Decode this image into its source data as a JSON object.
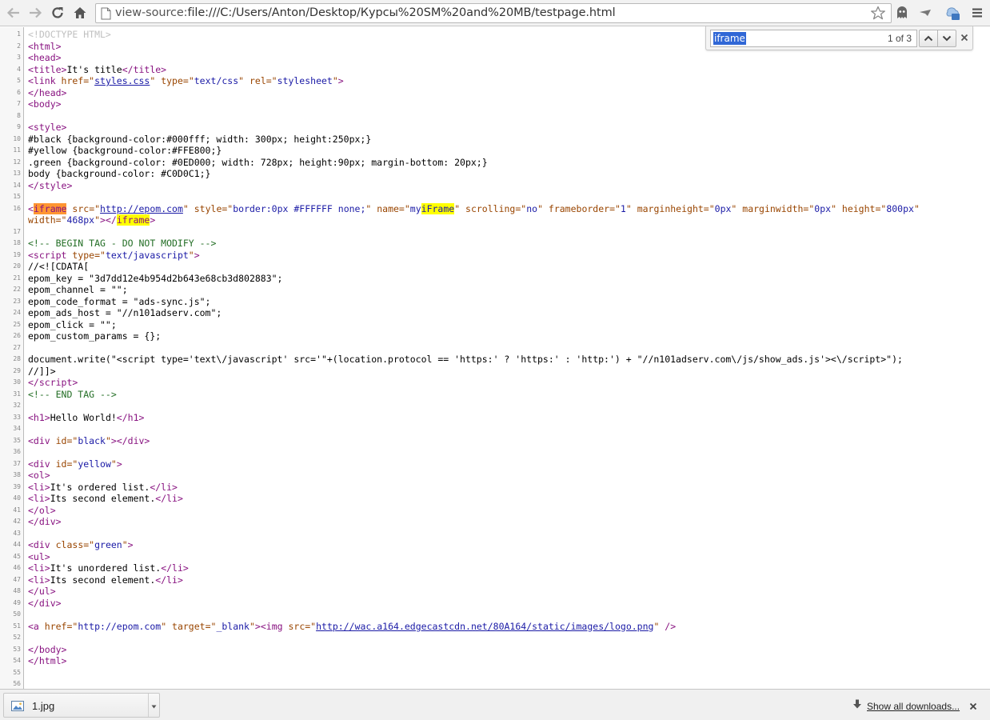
{
  "toolbar": {
    "url_scheme": "view-source:",
    "url_rest": "file:///C:/Users/Anton/Desktop/Курсы%20SM%20and%20MB/testpage.html"
  },
  "find": {
    "query": "iframe",
    "count": "1 of 3"
  },
  "source_lines": [
    {
      "n": "1",
      "html": "<span class=\"doctype\">&lt;!DOCTYPE HTML&gt;</span>"
    },
    {
      "n": "2",
      "html": "<span class=\"tag\">&lt;html&gt;</span>"
    },
    {
      "n": "3",
      "html": "<span class=\"tag\">&lt;head&gt;</span>"
    },
    {
      "n": "4",
      "html": "<span class=\"tag\">&lt;title&gt;</span>It's title<span class=\"tag\">&lt;/title&gt;</span>"
    },
    {
      "n": "5",
      "html": "<span class=\"tag\">&lt;link </span><span class=\"attr\">href=\"</span><span class=\"link\">styles.css</span><span class=\"attr\">\" </span><span class=\"attr\">type=\"</span><span class=\"val\">text/css</span><span class=\"attr\">\" rel=\"</span><span class=\"val\">stylesheet</span><span class=\"attr\">\"</span><span class=\"tag\">&gt;</span>"
    },
    {
      "n": "6",
      "html": "<span class=\"tag\">&lt;/head&gt;</span>"
    },
    {
      "n": "7",
      "html": "<span class=\"tag\">&lt;body&gt;</span>"
    },
    {
      "n": "8",
      "html": ""
    },
    {
      "n": "9",
      "html": "<span class=\"tag\">&lt;style&gt;</span>"
    },
    {
      "n": "10",
      "html": "#black {background-color:#000fff; width: 300px; height:250px;}"
    },
    {
      "n": "11",
      "html": "#yellow {background-color:#FFE800;}"
    },
    {
      "n": "12",
      "html": ".green {background-color: #0ED000; width: 728px; height:90px; margin-bottom: 20px;}"
    },
    {
      "n": "13",
      "html": "body {background-color: #C0D0C1;}"
    },
    {
      "n": "14",
      "html": "<span class=\"tag\">&lt;/style&gt;</span>"
    },
    {
      "n": "15",
      "html": ""
    },
    {
      "n": "16",
      "wrap": true,
      "html": "<span class=\"tag\">&lt;</span><span class=\"tag hl-cur\">iframe</span> <span class=\"attr\">src=\"</span><span class=\"link\">http://epom.com</span><span class=\"attr\">\" style=\"</span><span class=\"val\">border:0px #FFFFFF none;</span><span class=\"attr\">\" name=\"</span><span class=\"val\">my<span class=\"hl\">iFrame</span></span><span class=\"attr\">\" scrolling=\"</span><span class=\"val\">no</span><span class=\"attr\">\" frameborder=\"</span><span class=\"val\">1</span><span class=\"attr\">\" marginheight=\"</span><span class=\"val\">0px</span><span class=\"attr\">\" marginwidth=\"</span><span class=\"val\">0px</span><span class=\"attr\">\" height=\"</span><span class=\"val\">800px</span><span class=\"attr\">\"</span>\n<span class=\"attr\">width=\"</span><span class=\"val\">468px</span><span class=\"attr\">\"</span><span class=\"tag\">&gt;&lt;/<span class=\"hl\">iframe</span>&gt;</span>"
    },
    {
      "n": "17",
      "html": ""
    },
    {
      "n": "18",
      "html": "<span class=\"comment\">&lt;!-- BEGIN TAG - DO NOT MODIFY --&gt;</span>"
    },
    {
      "n": "19",
      "html": "<span class=\"tag\">&lt;script </span><span class=\"attr\">type=\"</span><span class=\"val\">text/javascript</span><span class=\"attr\">\"</span><span class=\"tag\">&gt;</span>"
    },
    {
      "n": "20",
      "html": "//&lt;![CDATA["
    },
    {
      "n": "21",
      "html": "epom_key = \"3d7dd12e4b954d2b643e68cb3d802883\";"
    },
    {
      "n": "22",
      "html": "epom_channel = \"\";"
    },
    {
      "n": "23",
      "html": "epom_code_format = \"ads-sync.js\";"
    },
    {
      "n": "24",
      "html": "epom_ads_host = \"//n101adserv.com\";"
    },
    {
      "n": "25",
      "html": "epom_click = \"\";"
    },
    {
      "n": "26",
      "html": "epom_custom_params = {};"
    },
    {
      "n": "27",
      "html": ""
    },
    {
      "n": "28",
      "html": "document.write(\"&lt;script type='text\\/javascript' src='\"+(location.protocol == 'https:' ? 'https:' : 'http:') + \"//n101adserv.com\\/js/show_ads.js'&gt;&lt;\\/script&gt;\");"
    },
    {
      "n": "29",
      "html": "//]]&gt;"
    },
    {
      "n": "30",
      "html": "<span class=\"tag\">&lt;/script&gt;</span>"
    },
    {
      "n": "31",
      "html": "<span class=\"comment\">&lt;!-- END TAG --&gt;</span>"
    },
    {
      "n": "32",
      "html": ""
    },
    {
      "n": "33",
      "html": "<span class=\"tag\">&lt;h1&gt;</span>Hello World!<span class=\"tag\">&lt;/h1&gt;</span>"
    },
    {
      "n": "34",
      "html": ""
    },
    {
      "n": "35",
      "html": "<span class=\"tag\">&lt;div </span><span class=\"attr\">id=\"</span><span class=\"val\">black</span><span class=\"attr\">\"</span><span class=\"tag\">&gt;&lt;/div&gt;</span>"
    },
    {
      "n": "36",
      "html": ""
    },
    {
      "n": "37",
      "html": "<span class=\"tag\">&lt;div </span><span class=\"attr\">id=\"</span><span class=\"val\">yellow</span><span class=\"attr\">\"</span><span class=\"tag\">&gt;</span>"
    },
    {
      "n": "38",
      "html": "<span class=\"tag\">&lt;ol&gt;</span>"
    },
    {
      "n": "39",
      "html": "<span class=\"tag\">&lt;li&gt;</span>It's ordered list.<span class=\"tag\">&lt;/li&gt;</span>"
    },
    {
      "n": "40",
      "html": "<span class=\"tag\">&lt;li&gt;</span>Its second element.<span class=\"tag\">&lt;/li&gt;</span>"
    },
    {
      "n": "41",
      "html": "<span class=\"tag\">&lt;/ol&gt;</span>"
    },
    {
      "n": "42",
      "html": "<span class=\"tag\">&lt;/div&gt;</span>"
    },
    {
      "n": "43",
      "html": ""
    },
    {
      "n": "44",
      "html": "<span class=\"tag\">&lt;div </span><span class=\"attr\">class=\"</span><span class=\"val\">green</span><span class=\"attr\">\"</span><span class=\"tag\">&gt;</span>"
    },
    {
      "n": "45",
      "html": "<span class=\"tag\">&lt;ul&gt;</span>"
    },
    {
      "n": "46",
      "html": "<span class=\"tag\">&lt;li&gt;</span>It's unordered list.<span class=\"tag\">&lt;/li&gt;</span>"
    },
    {
      "n": "47",
      "html": "<span class=\"tag\">&lt;li&gt;</span>Its second element.<span class=\"tag\">&lt;/li&gt;</span>"
    },
    {
      "n": "48",
      "html": "<span class=\"tag\">&lt;/ul&gt;</span>"
    },
    {
      "n": "49",
      "html": "<span class=\"tag\">&lt;/div&gt;</span>"
    },
    {
      "n": "50",
      "html": ""
    },
    {
      "n": "51",
      "html": "<span class=\"tag\">&lt;a </span><span class=\"attr\">href=\"</span><span class=\"val\">http://epom.com</span><span class=\"attr\">\" target=\"</span><span class=\"val\">_blank</span><span class=\"attr\">\"</span><span class=\"tag\">&gt;&lt;img </span><span class=\"attr\">src=\"</span><span class=\"link\">http://wac.a164.edgecastcdn.net/80A164/static/images/logo.png</span><span class=\"attr\">\" </span><span class=\"tag\">/&gt;</span>"
    },
    {
      "n": "52",
      "html": ""
    },
    {
      "n": "53",
      "html": "<span class=\"tag\">&lt;/body&gt;</span>"
    },
    {
      "n": "54",
      "html": "<span class=\"tag\">&lt;/html&gt;</span>"
    },
    {
      "n": "55",
      "html": ""
    },
    {
      "n": "56",
      "html": ""
    }
  ],
  "downloads": {
    "file_name": "1.jpg",
    "show_all": "Show all downloads..."
  },
  "icons": {
    "back": "back-arrow-icon",
    "forward": "forward-arrow-icon",
    "reload": "reload-icon",
    "home": "home-icon",
    "star": "star-icon",
    "ghost": "ghost-extension-icon",
    "menu": "hamburger-menu-icon"
  }
}
